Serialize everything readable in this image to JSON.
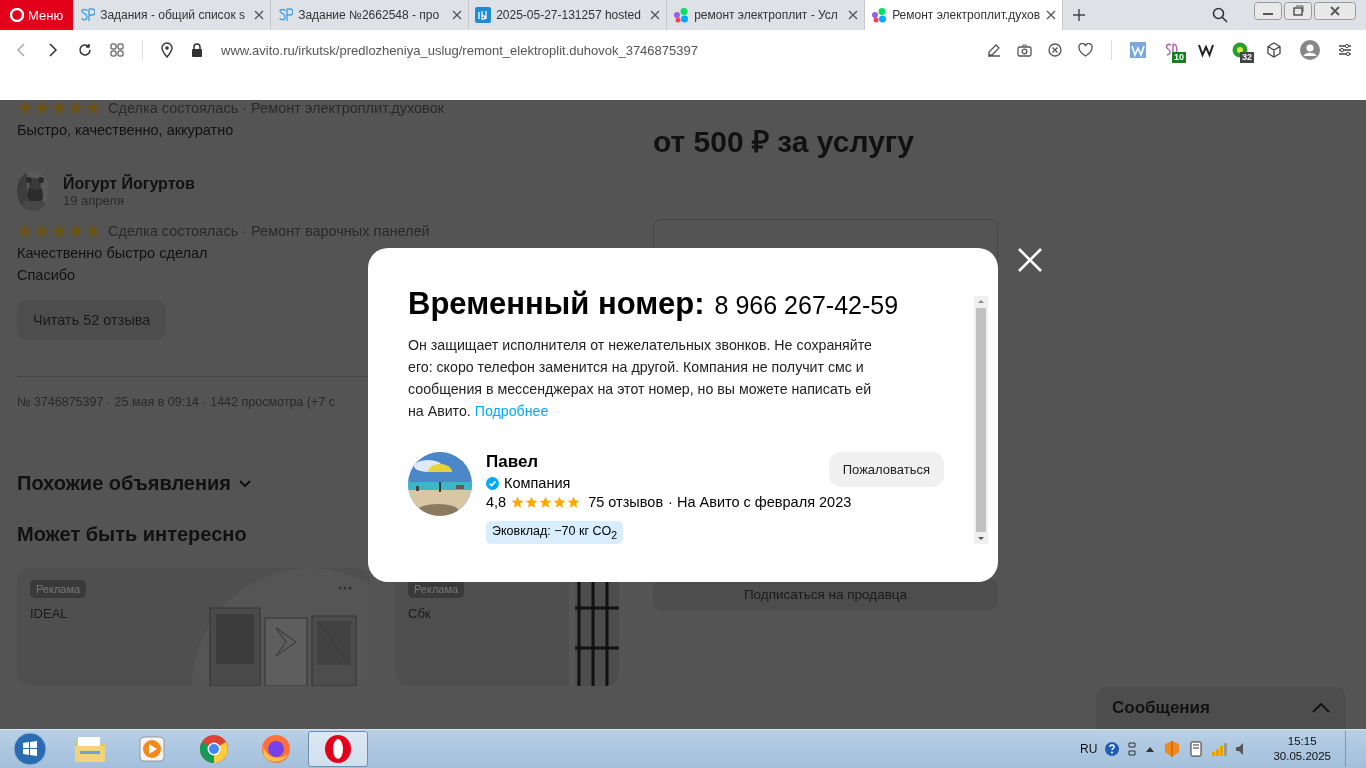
{
  "browser": {
    "menu_label": "Меню",
    "tabs": [
      {
        "title": "Задания - общий список s",
        "kind": "sp",
        "selected": false
      },
      {
        "title": "Задание №2662548 - про",
        "kind": "sp",
        "selected": false
      },
      {
        "title": "2025-05-27-131257 hosted",
        "kind": "ibb",
        "selected": false
      },
      {
        "title": "ремонт электроплит - Усл",
        "kind": "avito",
        "selected": false
      },
      {
        "title": "Ремонт электроплит.духов",
        "kind": "avito",
        "selected": true
      }
    ],
    "address": "www.avito.ru/irkutsk/predlozheniya_uslug/remont_elektroplit.duhovok_3746875397",
    "extensions": [
      {
        "kind": "w-blue"
      },
      {
        "kind": "sd",
        "badge": "10"
      },
      {
        "kind": "w-black"
      },
      {
        "kind": "green",
        "badge": "32"
      },
      {
        "kind": "cube"
      }
    ]
  },
  "page": {
    "reviews": [
      {
        "stars": 5,
        "deal": "Сделка состоялась · Ремонт электроплит.духовок",
        "lines": [
          "Быстро, качественно, аккуратно"
        ]
      },
      {
        "author": "Йогурт Йогуртов",
        "date": "19 апреля",
        "stars": 5,
        "deal": "Сделка состоялась · Ремонт варочных панелей",
        "lines": [
          "Качественно быстро сделал",
          "Спасибо"
        ]
      }
    ],
    "read_reviews_button": "Читать 52 отзыва",
    "meta": "№ 3746875397 · 25 мая в 09:14 · 1442 просмотра (+7 с",
    "similar_heading": "Похожие объявления",
    "interesting_heading": "Может быть интересно",
    "ads": [
      {
        "badge": "Реклама",
        "title": "IDEAL"
      },
      {
        "badge": "Реклама",
        "title": "Сбк"
      }
    ],
    "price": "от 500 ₽ за услугу",
    "subscribe_button": "Подписаться на продавца",
    "messages": "Сообщения"
  },
  "modal": {
    "title": "Временный номер:",
    "phone": "8 966 267-42-59",
    "text": "Он защищает исполнителя от нежелательных звонков. Не сохраняйте его: скоро телефон заменится на другой. Компания не получит смс и сообщения в мессенджерах на этот номер, но вы можете написать ей на Авито.",
    "link": "Подробнее",
    "seller": {
      "name": "Павел",
      "type": "Компания",
      "verified": true,
      "rating": "4,8",
      "stars": 5,
      "reviews": "75 отзывов",
      "since": "· На Авито с февраля 2023",
      "eco": "Эковклад: −70 кг CO$_{2}$"
    },
    "complain_button": "Пожаловаться"
  },
  "taskbar": {
    "apps": [
      {
        "kind": "explorer",
        "selected": false
      },
      {
        "kind": "media",
        "selected": false
      },
      {
        "kind": "chrome",
        "selected": false
      },
      {
        "kind": "firefox",
        "selected": false
      },
      {
        "kind": "opera",
        "selected": true
      }
    ],
    "language": "RU",
    "time": "15:15",
    "date": "30.05.2025"
  }
}
